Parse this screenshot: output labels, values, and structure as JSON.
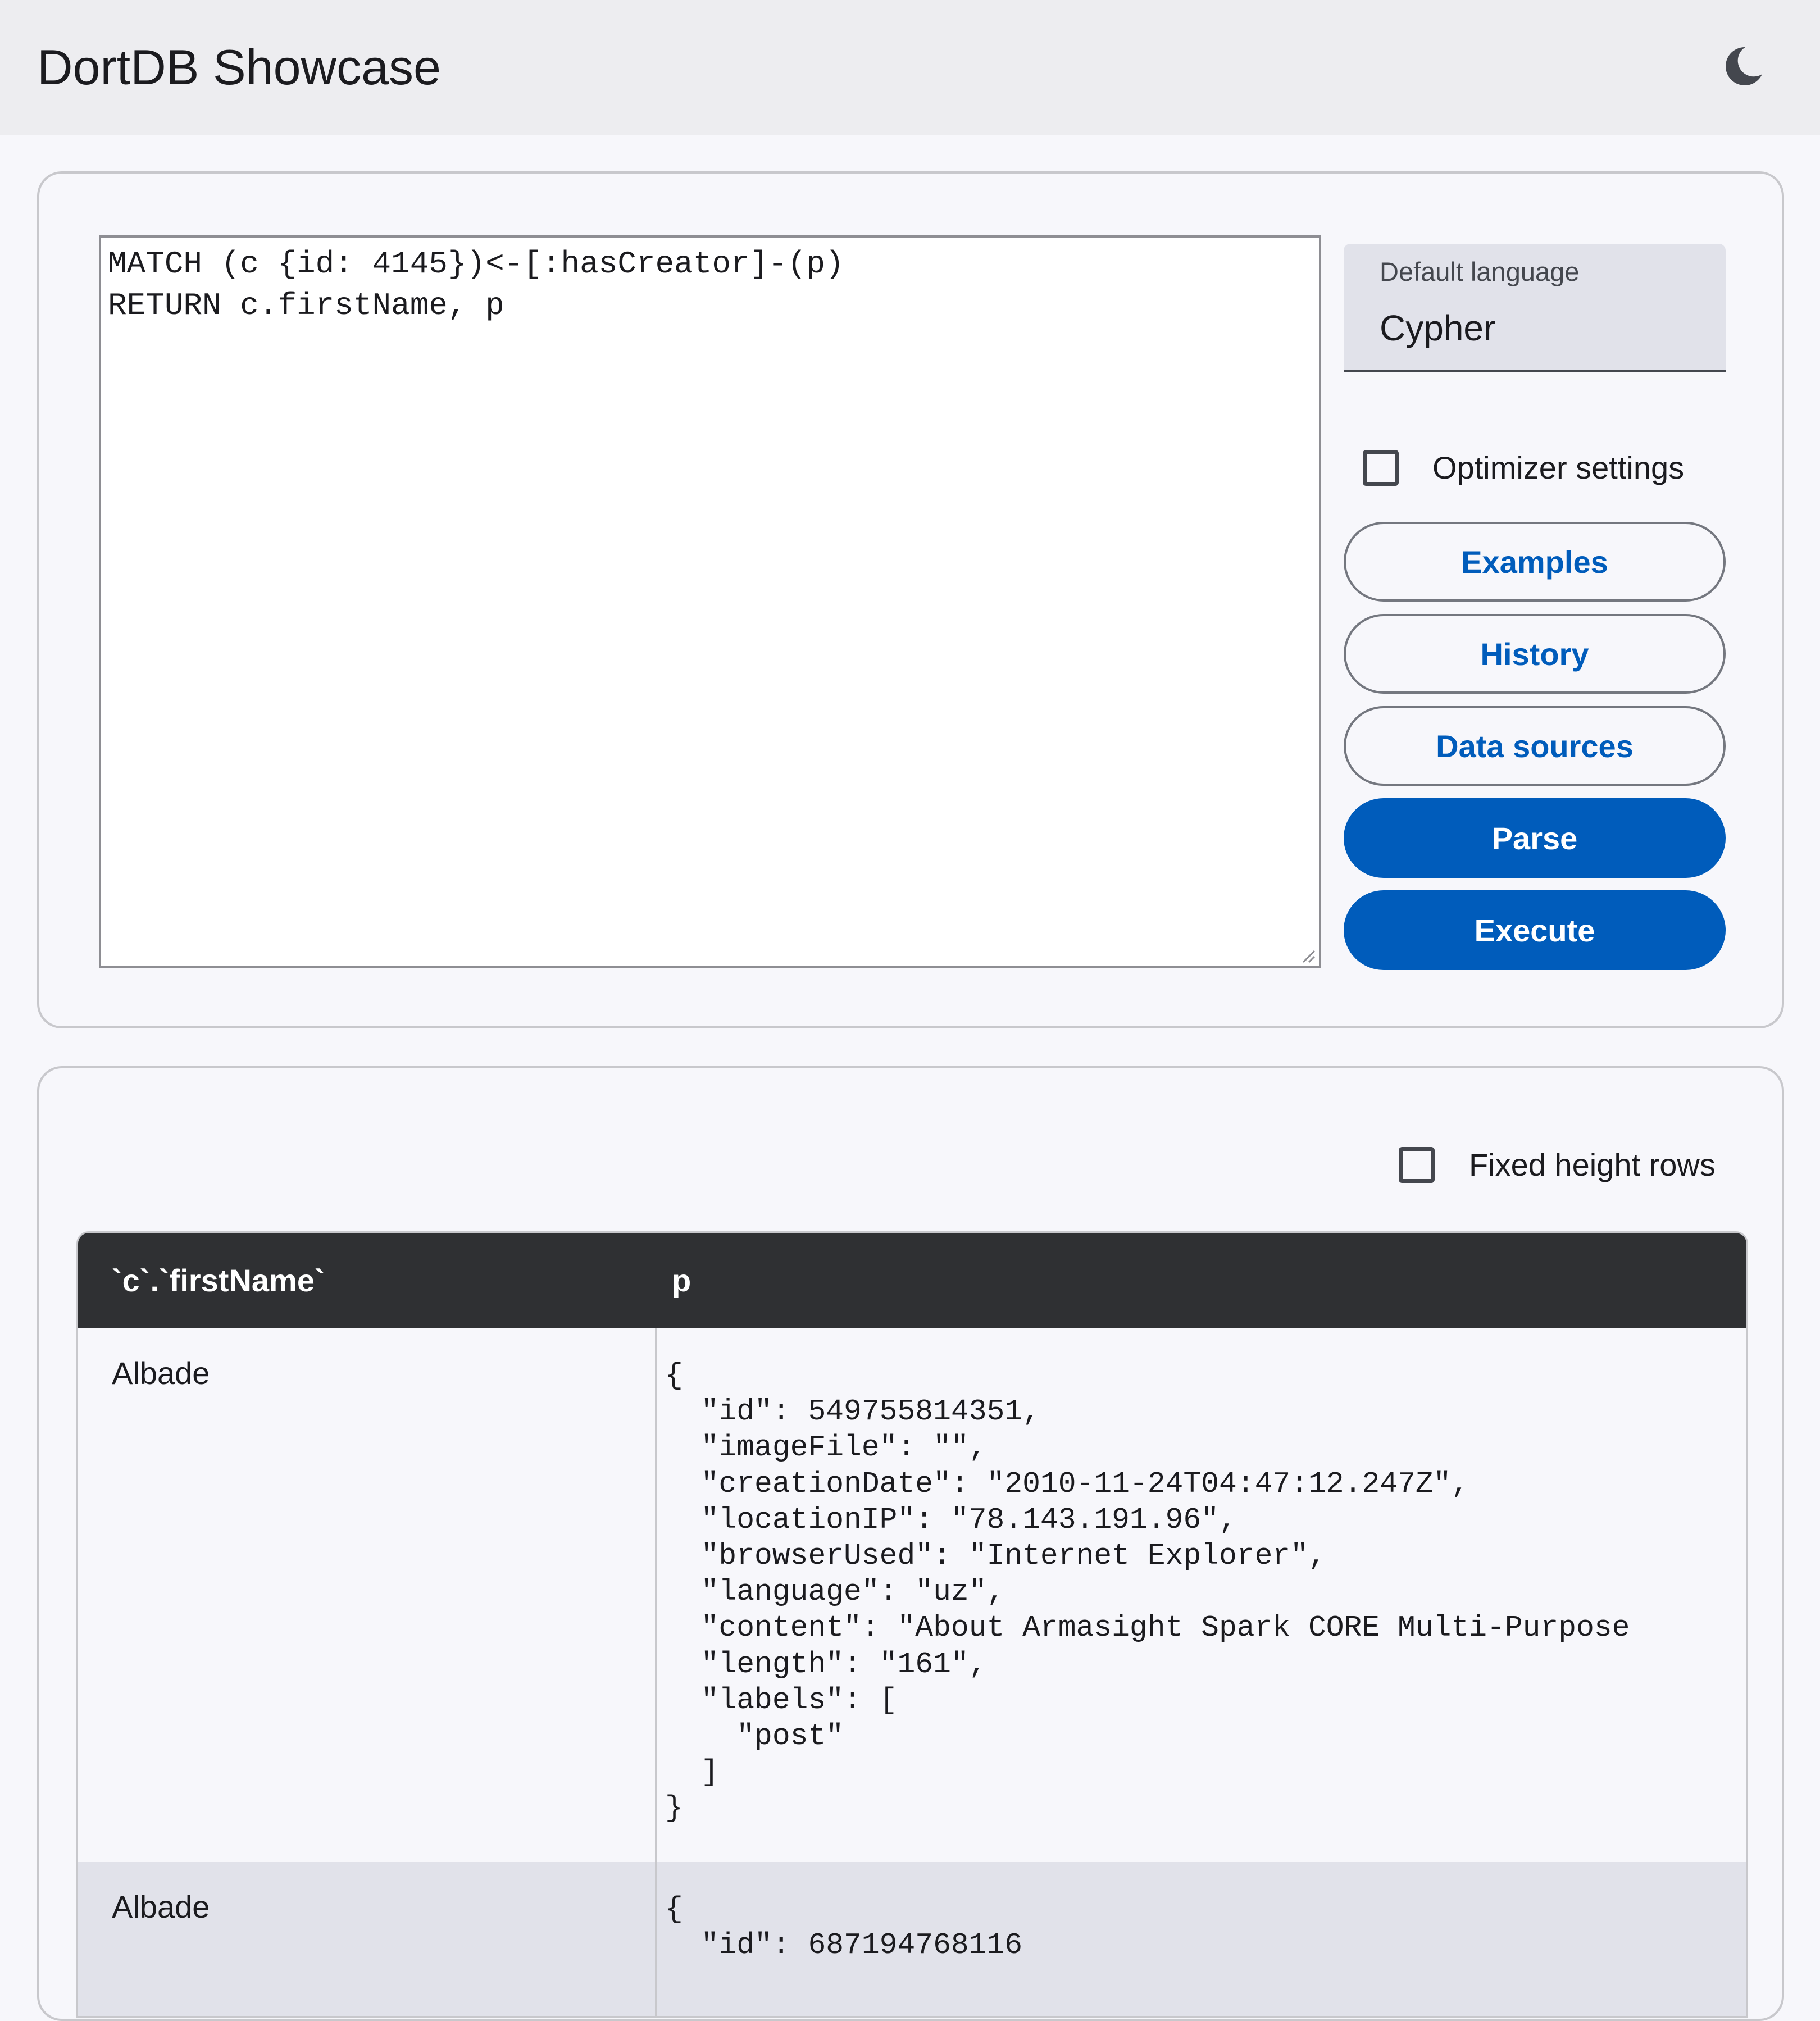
{
  "header": {
    "title": "DortDB Showcase",
    "theme_icon": "moon-icon"
  },
  "query": {
    "text": "MATCH (c {id: 4145})<-[:hasCreator]-(p)\nRETURN c.firstName, p",
    "language": {
      "label": "Default language",
      "value": "Cypher"
    },
    "optimizer": {
      "label": "Optimizer settings",
      "checked": false
    },
    "buttons": {
      "examples": "Examples",
      "history": "History",
      "data_sources": "Data sources",
      "parse": "Parse",
      "execute": "Execute"
    }
  },
  "results": {
    "fixed_height": {
      "label": "Fixed height rows",
      "checked": false
    },
    "columns": [
      "`c`.`firstName`",
      "p"
    ],
    "rows": [
      {
        "firstName": "Albade",
        "p": "{\n  \"id\": 549755814351,\n  \"imageFile\": \"\",\n  \"creationDate\": \"2010-11-24T04:47:12.247Z\",\n  \"locationIP\": \"78.143.191.96\",\n  \"browserUsed\": \"Internet Explorer\",\n  \"language\": \"uz\",\n  \"content\": \"About Armasight Spark CORE Multi-Purpose\n  \"length\": \"161\",\n  \"labels\": [\n    \"post\"\n  ]\n}"
      },
      {
        "firstName": "Albade",
        "p": "{\n  \"id\": 687194768116"
      }
    ]
  },
  "colors": {
    "primary": "#005cbb",
    "header_bg": "#2f3033",
    "topbar_bg": "#ededf0",
    "alt_row_bg": "#e1e2ea"
  }
}
